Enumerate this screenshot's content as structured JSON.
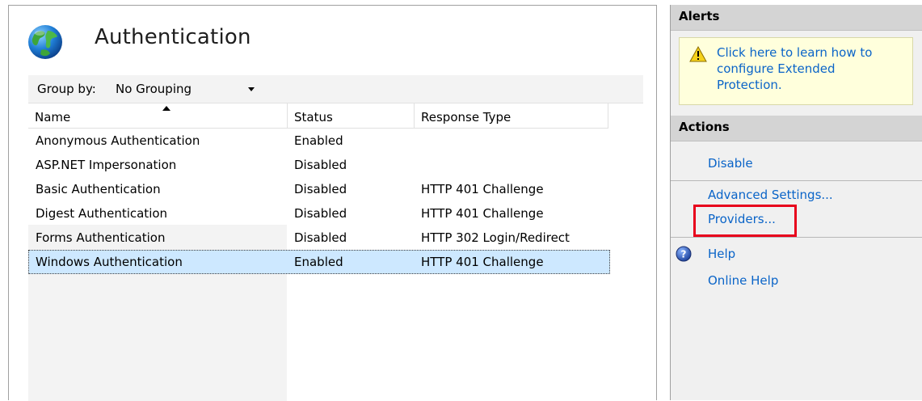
{
  "header": {
    "title": "Authentication"
  },
  "group_by": {
    "label": "Group by:",
    "value": "No Grouping"
  },
  "columns": [
    "Name",
    "Status",
    "Response Type"
  ],
  "rows": [
    {
      "name": "Anonymous Authentication",
      "status": "Enabled",
      "response": ""
    },
    {
      "name": "ASP.NET Impersonation",
      "status": "Disabled",
      "response": ""
    },
    {
      "name": "Basic Authentication",
      "status": "Disabled",
      "response": "HTTP 401 Challenge"
    },
    {
      "name": "Digest Authentication",
      "status": "Disabled",
      "response": "HTTP 401 Challenge"
    },
    {
      "name": "Forms Authentication",
      "status": "Disabled",
      "response": "HTTP 302 Login/Redirect"
    },
    {
      "name": "Windows Authentication",
      "status": "Enabled",
      "response": "HTTP 401 Challenge"
    }
  ],
  "selected_row": "Windows Authentication",
  "alerts": {
    "title": "Alerts",
    "message": "Click here to learn how to configure Extended Protection."
  },
  "actions": {
    "title": "Actions",
    "disable": "Disable",
    "advanced_settings": "Advanced Settings...",
    "providers": "Providers...",
    "help": "Help",
    "online_help": "Online Help"
  },
  "icons": {
    "page": "globe-icon",
    "alert": "warning-icon",
    "help": "help-icon",
    "sort": "sort-ascending-icon",
    "dropdown": "chevron-down-icon"
  },
  "colors": {
    "link": "#0a64c8",
    "selection": "#cde8ff",
    "highlight": "#e8001c",
    "alert_bg": "#ffffdc"
  }
}
